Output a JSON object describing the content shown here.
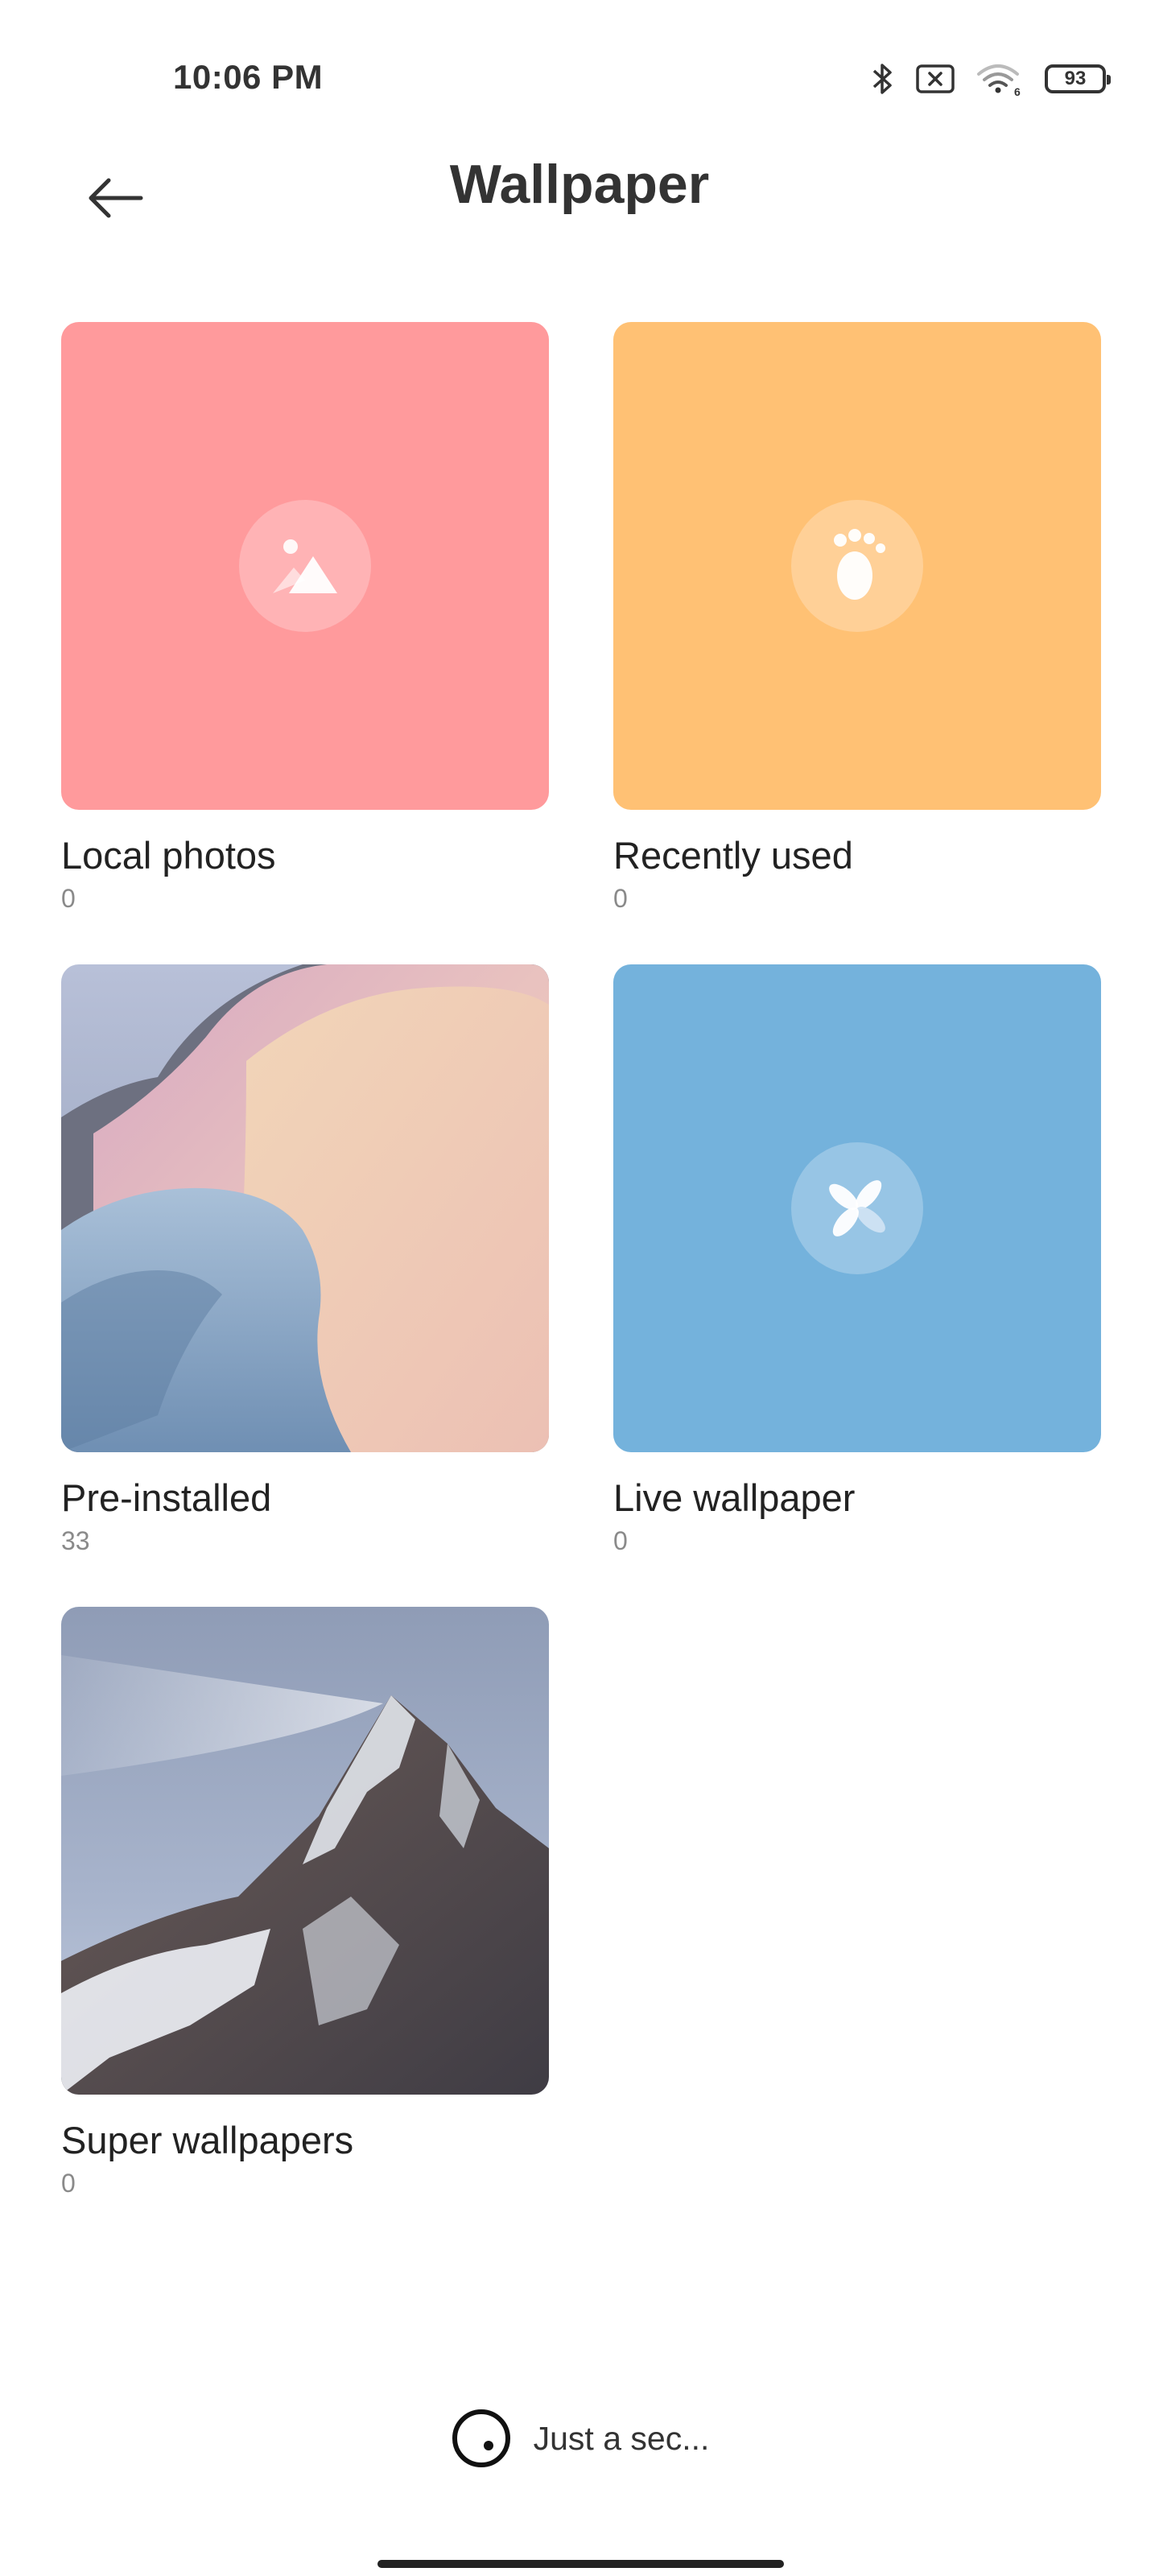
{
  "status_bar": {
    "time": "10:06 PM",
    "battery": "93",
    "icons": [
      "bluetooth-icon",
      "no-sim-icon",
      "wifi-6-icon",
      "battery-icon"
    ]
  },
  "header": {
    "title": "Wallpaper",
    "back_icon": "arrow-left-icon"
  },
  "categories": [
    {
      "label": "Local photos",
      "count": "0",
      "color": "#FF9A9C",
      "icon": "image-icon"
    },
    {
      "label": "Recently used",
      "count": "0",
      "color": "#FFC174",
      "icon": "footprint-icon"
    },
    {
      "label": "Pre-installed",
      "count": "33",
      "icon": "preview-image"
    },
    {
      "label": "Live wallpaper",
      "count": "0",
      "color": "#74B2DC",
      "icon": "pinwheel-icon"
    },
    {
      "label": "Super wallpapers",
      "count": "0",
      "icon": "preview-image"
    }
  ],
  "loader": {
    "text": "Just a sec..."
  }
}
